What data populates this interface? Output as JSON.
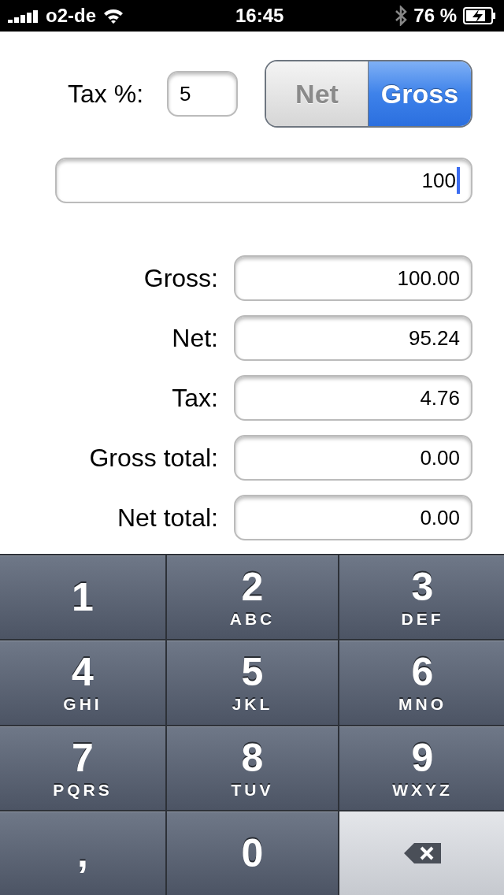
{
  "status_bar": {
    "carrier": "o2-de",
    "time": "16:45",
    "battery": "76 %"
  },
  "tax": {
    "label": "Tax %:",
    "value": "5"
  },
  "mode": [
    {
      "label": "Net",
      "selected": false
    },
    {
      "label": "Gross",
      "selected": true
    }
  ],
  "amount_field": {
    "value": "100",
    "focused": true
  },
  "results": [
    {
      "label": "Gross:",
      "value": "100.00"
    },
    {
      "label": "Net:",
      "value": "95.24"
    },
    {
      "label": "Tax:",
      "value": "4.76"
    },
    {
      "label": "Gross total:",
      "value": "0.00"
    },
    {
      "label": "Net total:",
      "value": "0.00"
    }
  ],
  "keypad": [
    {
      "kind": "digit",
      "digit": "1"
    },
    {
      "kind": "digit",
      "digit": "2",
      "letters": "ABC"
    },
    {
      "kind": "digit",
      "digit": "3",
      "letters": "DEF"
    },
    {
      "kind": "digit",
      "digit": "4",
      "letters": "GHI"
    },
    {
      "kind": "digit",
      "digit": "5",
      "letters": "JKL"
    },
    {
      "kind": "digit",
      "digit": "6",
      "letters": "MNO"
    },
    {
      "kind": "digit",
      "digit": "7",
      "letters": "PQRS"
    },
    {
      "kind": "digit",
      "digit": "8",
      "letters": "TUV"
    },
    {
      "kind": "digit",
      "digit": "9",
      "letters": "WXYZ"
    },
    {
      "kind": "symbol",
      "digit": ","
    },
    {
      "kind": "digit",
      "digit": "0"
    },
    {
      "kind": "delete"
    }
  ]
}
